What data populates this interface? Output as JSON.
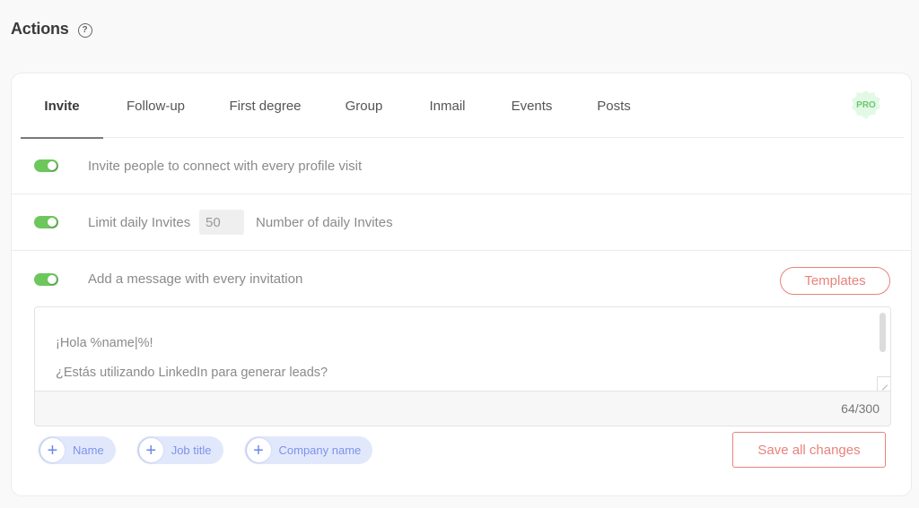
{
  "header": {
    "title": "Actions",
    "help_icon": "question-circle-icon",
    "help_glyph": "?"
  },
  "tabs": [
    {
      "label": "Invite",
      "active": true
    },
    {
      "label": "Follow-up",
      "active": false
    },
    {
      "label": "First degree",
      "active": false
    },
    {
      "label": "Group",
      "active": false
    },
    {
      "label": "Inmail",
      "active": false
    },
    {
      "label": "Events",
      "active": false
    },
    {
      "label": "Posts",
      "active": false
    }
  ],
  "pro_badge": {
    "label": "PRO",
    "color": "#6dc76d",
    "bg": "#e2f9e6"
  },
  "settings": {
    "invite_on_visit": {
      "enabled": true,
      "label": "Invite people to connect with every profile visit"
    },
    "limit_daily": {
      "enabled": true,
      "label": "Limit daily Invites",
      "value": "50",
      "suffix_label": "Number of daily Invites"
    },
    "add_message": {
      "enabled": true,
      "label": "Add a message with every invitation"
    }
  },
  "templates_button": "Templates",
  "message": {
    "text": "¡Hola %name|%!\n¿Estás utilizando LinkedIn para generar leads?",
    "char_count": "64/300"
  },
  "variables": [
    {
      "label": "Name",
      "icon": "plus-icon"
    },
    {
      "label": "Job title",
      "icon": "plus-icon"
    },
    {
      "label": "Company name",
      "icon": "plus-icon"
    }
  ],
  "save_button": "Save all changes",
  "colors": {
    "toggle_on": "#6dc75d",
    "accent": "#e8837b",
    "chip_bg": "#e2e8fc",
    "chip_text": "#7d93ea"
  }
}
